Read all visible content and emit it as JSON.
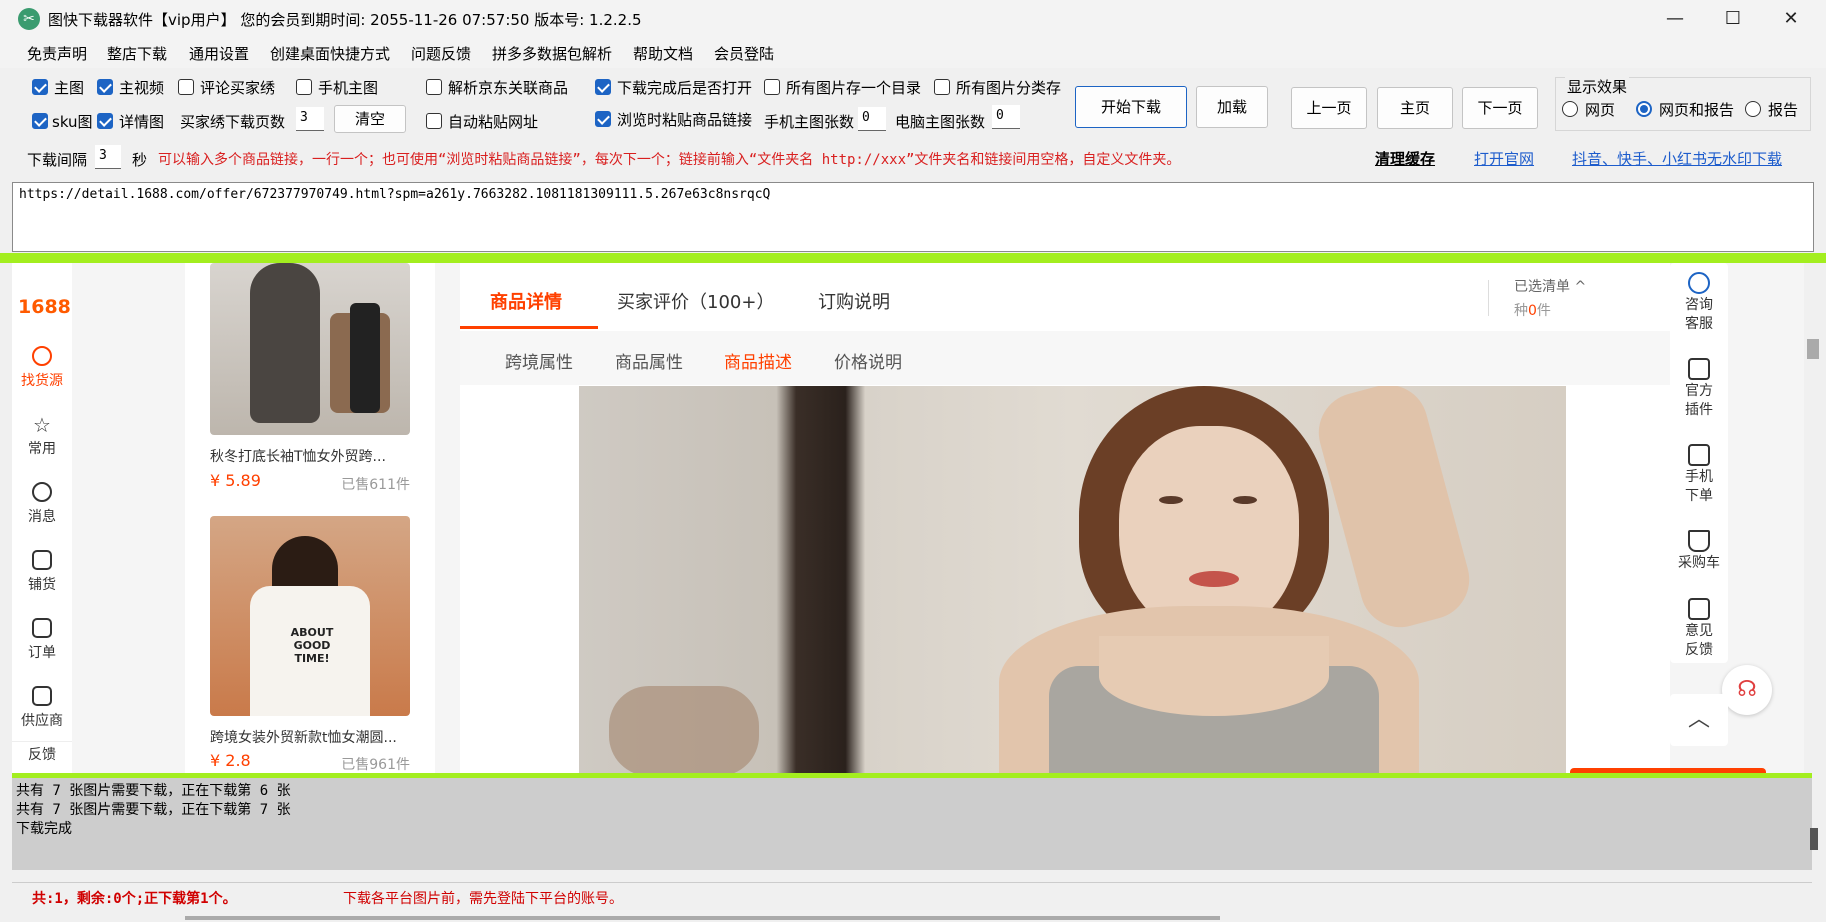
{
  "window": {
    "title": "图快下载器软件【vip用户】 您的会员到期时间: 2055-11-26 07:57:50  版本号: 1.2.2.5",
    "minimize": "—",
    "maximize": "☐",
    "close": "✕"
  },
  "menu": [
    "免责声明",
    "整店下载",
    "通用设置",
    "创建桌面快捷方式",
    "问题反馈",
    "拼多多数据包解析",
    "帮助文档",
    "会员登陆"
  ],
  "options": {
    "main_image": "主图",
    "main_video": "主视频",
    "review_buyer_show": "评论买家绣",
    "mobile_main_image": "手机主图",
    "parse_jd": "解析京东关联商品",
    "open_after_done": "下载完成后是否打开",
    "all_in_one_dir": "所有图片存一个目录",
    "classify_all": "所有图片分类存",
    "sku_image": "sku图",
    "detail_image": "详情图",
    "buyer_show_pages_label": "买家绣下载页数",
    "buyer_show_pages_value": "3",
    "clear_button": "清空",
    "auto_paste": "自动粘贴网址",
    "paste_on_browse": "浏览时粘贴商品链接",
    "mobile_count_label": "手机主图张数",
    "mobile_count_value": "0",
    "pc_count_label": "电脑主图张数",
    "pc_count_value": "0",
    "interval_label": "下载间隔",
    "interval_value": "3",
    "interval_unit": "秒"
  },
  "buttons": {
    "start": "开始下载",
    "load": "加载",
    "prev": "上一页",
    "home": "主页",
    "next": "下一页"
  },
  "display": {
    "title": "显示效果",
    "opt_web": "网页",
    "opt_web_report": "网页和报告",
    "opt_report": "报告"
  },
  "hint": "可以输入多个商品链接，一行一个；也可使用“浏览时粘贴商品链接”，每次下一个；链接前输入“文件夹名 http://xxx”文件夹名和链接间用空格，自定义文件夹。",
  "links": {
    "clear_cache": "清理缓存",
    "official_site": "打开官网",
    "no_watermark": "抖音、快手、小红书无水印下载"
  },
  "url": "https://detail.1688.com/offer/672377970749.html?spm=a261y.7663282.1081181309111.5.267e63c8nsrqcQ",
  "browser": {
    "logo": "1688",
    "nav": [
      "找货源",
      "常用",
      "消息",
      "铺货",
      "订单",
      "供应商",
      "反馈"
    ],
    "products": [
      {
        "title": "秋冬打底长袖T恤女外贸跨...",
        "price": "¥ 5.89",
        "sold": "已售611件"
      },
      {
        "title": "跨境女装外贸新款t恤女潮圆...",
        "price": "¥ 2.8",
        "sold": "已售961件"
      }
    ],
    "shirt_text": "ABOUT GOOD TIME!",
    "tabs": [
      "商品详情",
      "买家评价（100+）",
      "订购说明"
    ],
    "subtabs": [
      "跨境属性",
      "商品属性",
      "商品描述",
      "价格说明"
    ],
    "selected_list": "已选清单 ^",
    "selected_prefix": "种",
    "selected_num": "0",
    "selected_suffix": "件",
    "side": [
      {
        "l1": "咨询",
        "l2": "客服"
      },
      {
        "l1": "官方",
        "l2": "插件"
      },
      {
        "l1": "手机",
        "l2": "下单"
      },
      {
        "l1": "采购车",
        "l2": ""
      },
      {
        "l1": "意见",
        "l2": "反馈"
      }
    ],
    "up_icon": "︿"
  },
  "log": [
    "共有 7 张图片需要下载，正在下载第 6 张",
    "共有 7 张图片需要下载，正在下载第 7 张",
    "下载完成"
  ],
  "status": {
    "left": "共:1，剩余:0个;正下载第1个。",
    "right": "下载各平台图片前，需先登陆下平台的账号。"
  },
  "colors": {
    "accent": "#1d64c4",
    "brand_1688": "#ff5a00",
    "green_bar": "#a3ee1f",
    "warn_red": "#d92020"
  }
}
